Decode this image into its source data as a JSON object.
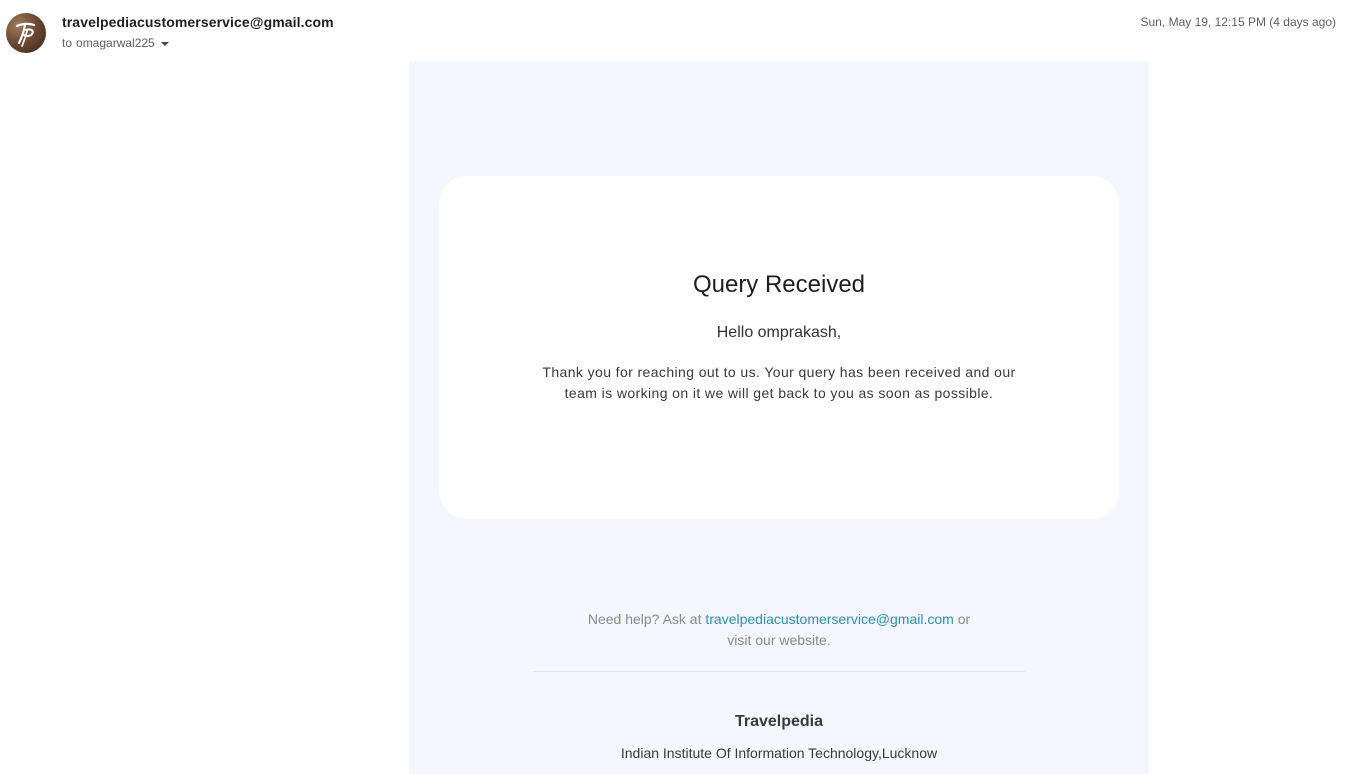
{
  "header": {
    "sender_email": "travelpediacustomerservice@gmail.com",
    "recipient_prefix": "to",
    "recipient": "omagarwal225",
    "timestamp": "Sun, May 19, 12:15 PM (4 days ago)",
    "avatar_icon": "travelpedia-logo-icon"
  },
  "email": {
    "card": {
      "title": "Query Received",
      "greeting": "Hello omprakash,",
      "message": "Thank you for reaching out to us. Your query has been received and our team is working on it we will get back to you as soon as possible."
    },
    "help": {
      "prefix": "Need help? Ask at",
      "email_link": "travelpediacustomerservice@gmail.com",
      "middle": "or",
      "website_text": "visit our website."
    },
    "footer": {
      "company": "Travelpedia",
      "address": "Indian Institute Of Information Technology,Lucknow"
    }
  },
  "colors": {
    "body_background": "#f4f7fe",
    "card_background": "#ffffff",
    "link": "#2f8fb0",
    "muted_text": "#8a8a8a"
  }
}
